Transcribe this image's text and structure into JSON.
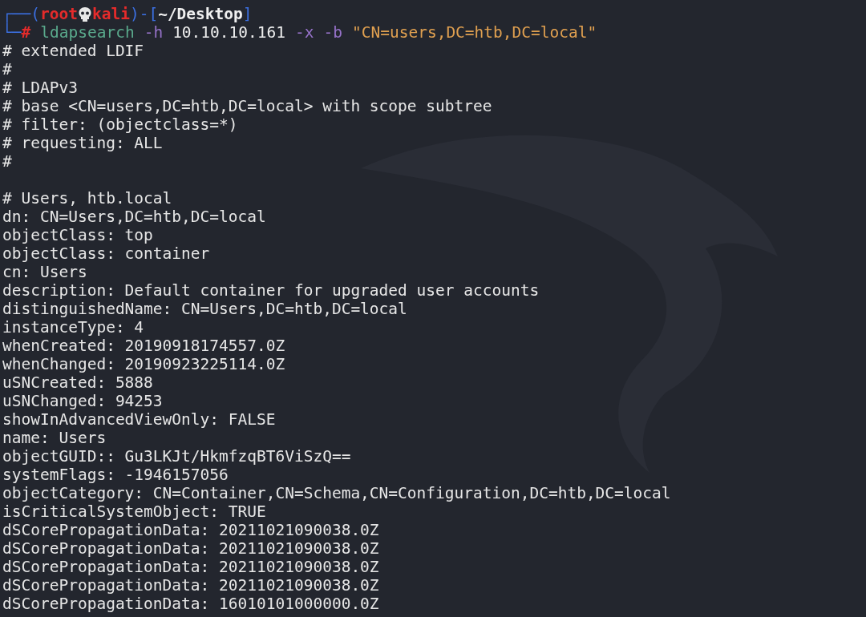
{
  "prompt": {
    "open": "┌──(",
    "user": "root",
    "host": "kali",
    "close": ")-[",
    "path": "~/Desktop",
    "end": "]",
    "corner": "└─",
    "symbol": "#"
  },
  "command": [
    {
      "kind": "program",
      "text": "ldapsearch"
    },
    {
      "kind": "flag",
      "text": "-h"
    },
    {
      "kind": "arg",
      "text": "10.10.10.161"
    },
    {
      "kind": "flag",
      "text": "-x"
    },
    {
      "kind": "flag",
      "text": "-b"
    },
    {
      "kind": "string",
      "text": "\"CN=users,DC=htb,DC=local\""
    }
  ],
  "output_blocks": [
    [
      "# extended LDIF",
      "#",
      "# LDAPv3",
      "# base <CN=users,DC=htb,DC=local> with scope subtree",
      "# filter: (objectclass=*)",
      "# requesting: ALL",
      "#"
    ],
    [
      "# Users, htb.local",
      "dn: CN=Users,DC=htb,DC=local",
      "objectClass: top",
      "objectClass: container",
      "cn: Users",
      "description: Default container for upgraded user accounts",
      "distinguishedName: CN=Users,DC=htb,DC=local",
      "instanceType: 4",
      "whenCreated: 20190918174557.0Z",
      "whenChanged: 20190923225114.0Z",
      "uSNCreated: 5888",
      "uSNChanged: 94253",
      "showInAdvancedViewOnly: FALSE",
      "name: Users",
      "objectGUID:: Gu3LKJt/HkmfzqBT6ViSzQ==",
      "systemFlags: -1946157056",
      "objectCategory: CN=Container,CN=Schema,CN=Configuration,DC=htb,DC=local",
      "isCriticalSystemObject: TRUE",
      "dSCorePropagationData: 20211021090038.0Z",
      "dSCorePropagationData: 20211021090038.0Z",
      "dSCorePropagationData: 20211021090038.0Z",
      "dSCorePropagationData: 20211021090038.0Z",
      "dSCorePropagationData: 16010101000000.0Z"
    ]
  ]
}
